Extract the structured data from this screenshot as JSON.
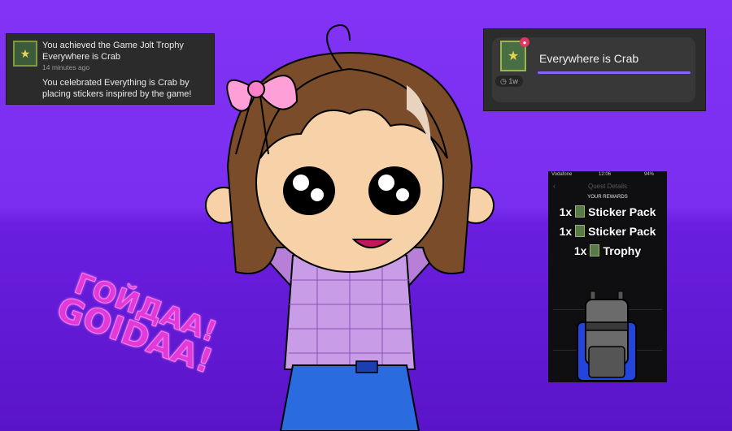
{
  "notification": {
    "title_line1": "You achieved the Game Jolt Trophy",
    "title_line2": "Everywhere is Crab",
    "timestamp": "14 minutes ago",
    "body": "You celebrated Everything is Crab by placing stickers inspired by the game!"
  },
  "trophy_card": {
    "name": "Everywhere is Crab",
    "age": "1w",
    "accent": "#8a62ff"
  },
  "phone": {
    "status_left": "Vodafone",
    "time": "12:06",
    "battery": "94%",
    "header": "Quest Details",
    "rewards_label": "YOUR REWARDS",
    "rewards": [
      {
        "qty": "1x",
        "label": "Sticker Pack"
      },
      {
        "qty": "1x",
        "label": "Sticker Pack"
      },
      {
        "qty": "1x",
        "label": "Trophy"
      }
    ]
  },
  "overlay_text": {
    "line1": "ГОЙДАА!",
    "line2": "GOIDAA!"
  },
  "colors": {
    "bg_top": "#8233f5",
    "bg_bottom": "#5a14c8",
    "sticker_pink": "#e23ad8"
  }
}
